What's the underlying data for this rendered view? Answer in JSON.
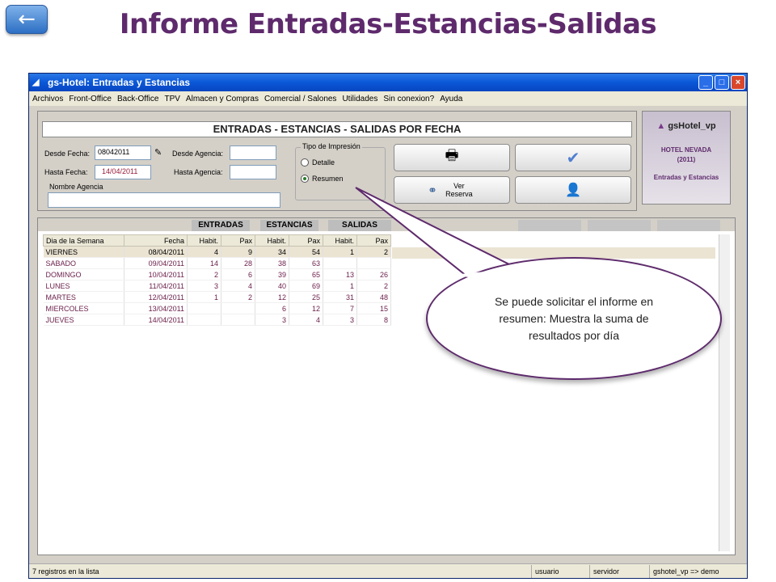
{
  "slide": {
    "title": "Informe Entradas-Estancias-Salidas",
    "back_icon": "←"
  },
  "window": {
    "title": "gs-Hotel: Entradas y Estancias",
    "buttons": [
      "_",
      "□",
      "×"
    ]
  },
  "menu": [
    "Archivos",
    "Front-Office",
    "Back-Office",
    "TPV",
    "Almacen y Compras",
    "Comercial / Salones",
    "Utilidades",
    "Sin conexion?",
    "Ayuda"
  ],
  "form": {
    "banner": "ENTRADAS - ESTANCIAS - SALIDAS POR FECHA",
    "desde_fecha_label": "Desde Fecha:",
    "desde_fecha_value": "08042011",
    "hasta_fecha_label": "Hasta Fecha:",
    "hasta_fecha_value": "14/04/2011",
    "desde_agencia_label": "Desde Agencia:",
    "hasta_agencia_label": "Hasta Agencia:",
    "nombre_agencia_label": "Nombre Agencia",
    "tipo_label": "Tipo de Impresión",
    "opt_detalle": "Detalle",
    "opt_resumen": "Resumen",
    "ver_reserva": "Ver Reserva"
  },
  "logo": {
    "brand": "gsHotel_vp",
    "hotel": "HOTEL NEVADA",
    "year": "(2011)",
    "module": "Entradas y Estancias"
  },
  "grid": {
    "group_headers": [
      "ENTRADAS",
      "ESTANCIAS",
      "SALIDAS"
    ],
    "columns": [
      "Dia de la Semana",
      "Fecha",
      "Habit.",
      "Pax",
      "Habit.",
      "Pax",
      "Habit.",
      "Pax"
    ],
    "rows": [
      [
        "VIERNES",
        "08/04/2011",
        "4",
        "9",
        "34",
        "54",
        "1",
        "2"
      ],
      [
        "SABADO",
        "09/04/2011",
        "14",
        "28",
        "38",
        "63",
        "",
        ""
      ],
      [
        "DOMINGO",
        "10/04/2011",
        "2",
        "6",
        "39",
        "65",
        "13",
        "26"
      ],
      [
        "LUNES",
        "11/04/2011",
        "3",
        "4",
        "40",
        "69",
        "1",
        "2"
      ],
      [
        "MARTES",
        "12/04/2011",
        "1",
        "2",
        "12",
        "25",
        "31",
        "48"
      ],
      [
        "MIERCOLES",
        "13/04/2011",
        "",
        "",
        "6",
        "12",
        "7",
        "15"
      ],
      [
        "JUEVES",
        "14/04/2011",
        "",
        "",
        "3",
        "4",
        "3",
        "8"
      ]
    ]
  },
  "status": {
    "count": "7 registros en la lista",
    "user": "usuario",
    "server": "servidor",
    "db": "gshotel_vp => demo"
  },
  "callout": "Se puede solicitar el informe en resumen: Muestra la suma de resultados por día",
  "colors": {
    "title": "#5e2a6c",
    "titlebar": "#0a58d8",
    "row_text": "#6a1e4a"
  }
}
